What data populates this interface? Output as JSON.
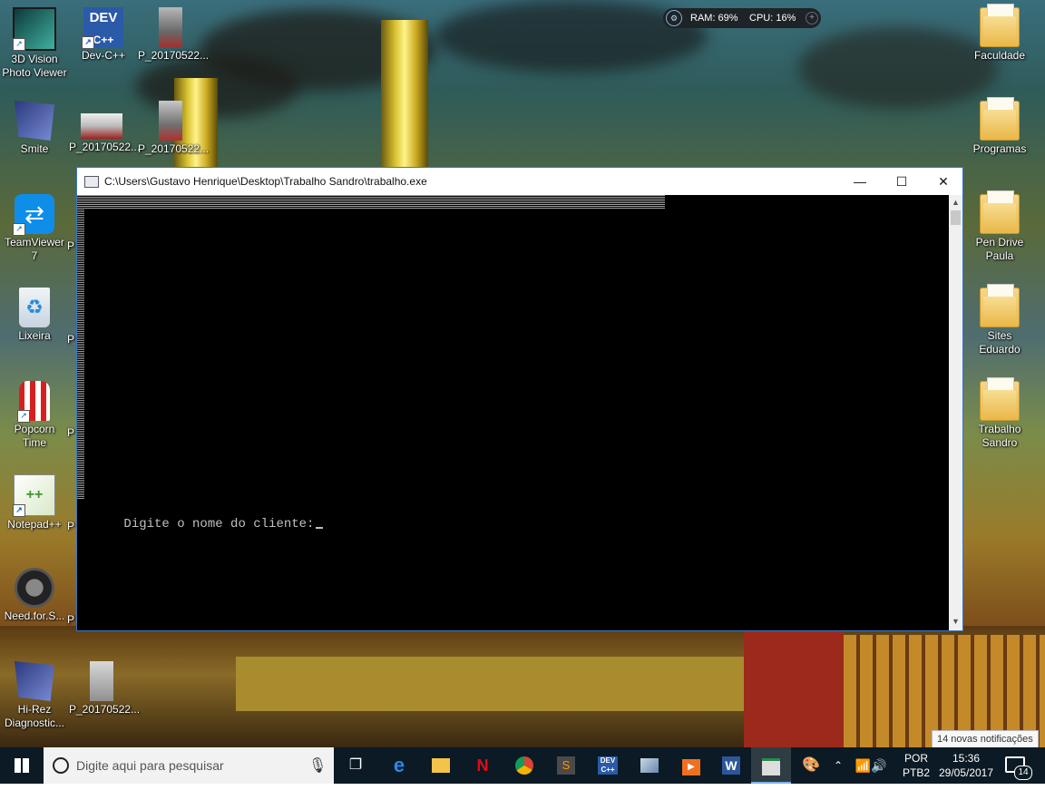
{
  "desktop": {
    "left_icons": [
      {
        "label": "3D Vision Photo Viewer",
        "icon": "3d-vision-icon"
      },
      {
        "label": "Dev-C++",
        "icon": "devcpp-icon"
      },
      {
        "label": "P_20170522...",
        "icon": "photo-icon"
      },
      {
        "label": "Smite",
        "icon": "hirez-icon"
      },
      {
        "label": "P_20170522...",
        "icon": "photo-icon"
      },
      {
        "label": "P_20170522...",
        "icon": "photo-icon"
      },
      {
        "label": "TeamViewer 7",
        "icon": "teamviewer-icon"
      },
      {
        "label": "Lixeira",
        "icon": "recycle-bin-icon"
      },
      {
        "label": "Popcorn Time",
        "icon": "popcorn-icon"
      },
      {
        "label": "Notepad++",
        "icon": "notepadpp-icon"
      },
      {
        "label": "Need.for.S...",
        "icon": "nfs-icon"
      },
      {
        "label": "Hi-Rez Diagnostic...",
        "icon": "hirez-icon"
      },
      {
        "label": "P_20170522...",
        "icon": "photo-icon"
      }
    ],
    "right_icons": [
      {
        "label": "Faculdade",
        "icon": "folder-icon"
      },
      {
        "label": "Programas",
        "icon": "folder-icon"
      },
      {
        "label": "Pen Drive Paula",
        "icon": "folder-icon"
      },
      {
        "label": "Sites Eduardo",
        "icon": "folder-icon"
      },
      {
        "label": "Trabalho Sandro",
        "icon": "folder-icon"
      }
    ],
    "clipped_letter": "P"
  },
  "perf_widget": {
    "ram": "RAM: 69%",
    "cpu": "CPU: 16%"
  },
  "console": {
    "title": "C:\\Users\\Gustavo Henrique\\Desktop\\Trabalho Sandro\\trabalho.exe",
    "prompt": "Digite o nome do cliente:",
    "minimize": "—",
    "maximize": "☐",
    "close": "✕"
  },
  "taskbar": {
    "search_placeholder": "Digite aqui para pesquisar",
    "lang_top": "POR",
    "lang_bottom": "PTB2",
    "time": "15:36",
    "date": "29/05/2017",
    "notification_count": "14",
    "apps": [
      "task-view-icon",
      "edge-icon",
      "file-explorer-icon",
      "netflix-icon",
      "chrome-icon",
      "sublime-icon",
      "devcpp-icon",
      "photos-icon",
      "media-player-icon",
      "word-icon",
      "console-icon",
      "paint-icon"
    ]
  },
  "notification_toast": "14 novas notificações"
}
